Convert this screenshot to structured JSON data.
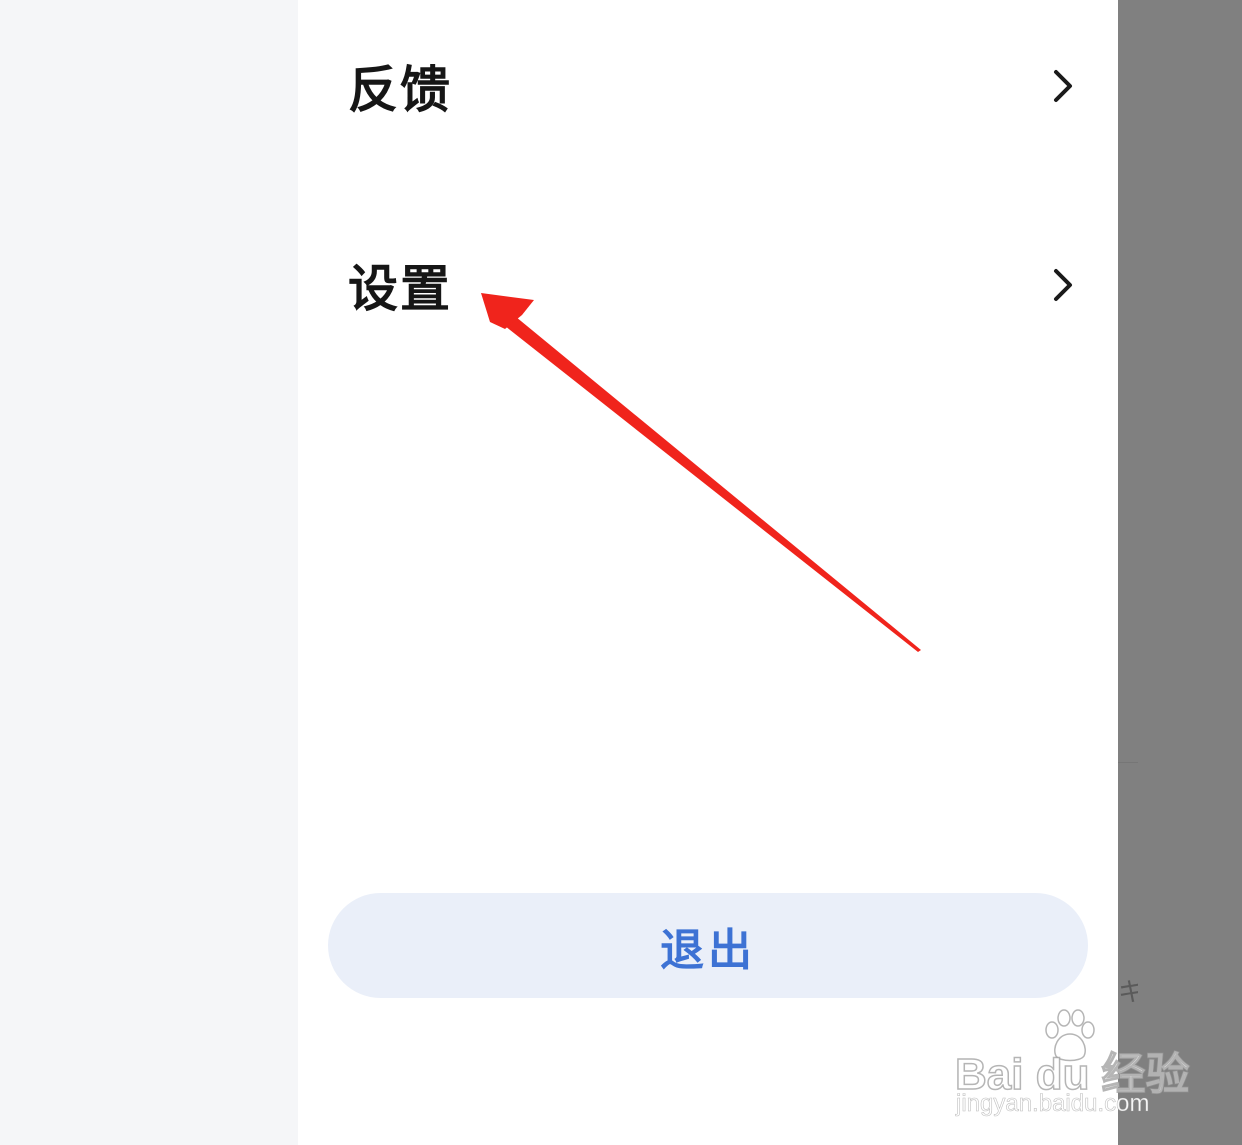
{
  "menu": {
    "items": [
      {
        "label": "反馈",
        "icon": "chevron-right-icon"
      },
      {
        "label": "设置",
        "icon": "chevron-right-icon"
      }
    ]
  },
  "logout": {
    "label": "退出"
  },
  "annotation": {
    "color": "#f0241c",
    "icon": "red-arrow"
  },
  "watermark": {
    "brand": "Bai du 经验",
    "url": "jingyan.baidu.com"
  },
  "colors": {
    "accent": "#3d72d4",
    "logout_bg": "#eaeff9",
    "overlay": "#808080"
  }
}
